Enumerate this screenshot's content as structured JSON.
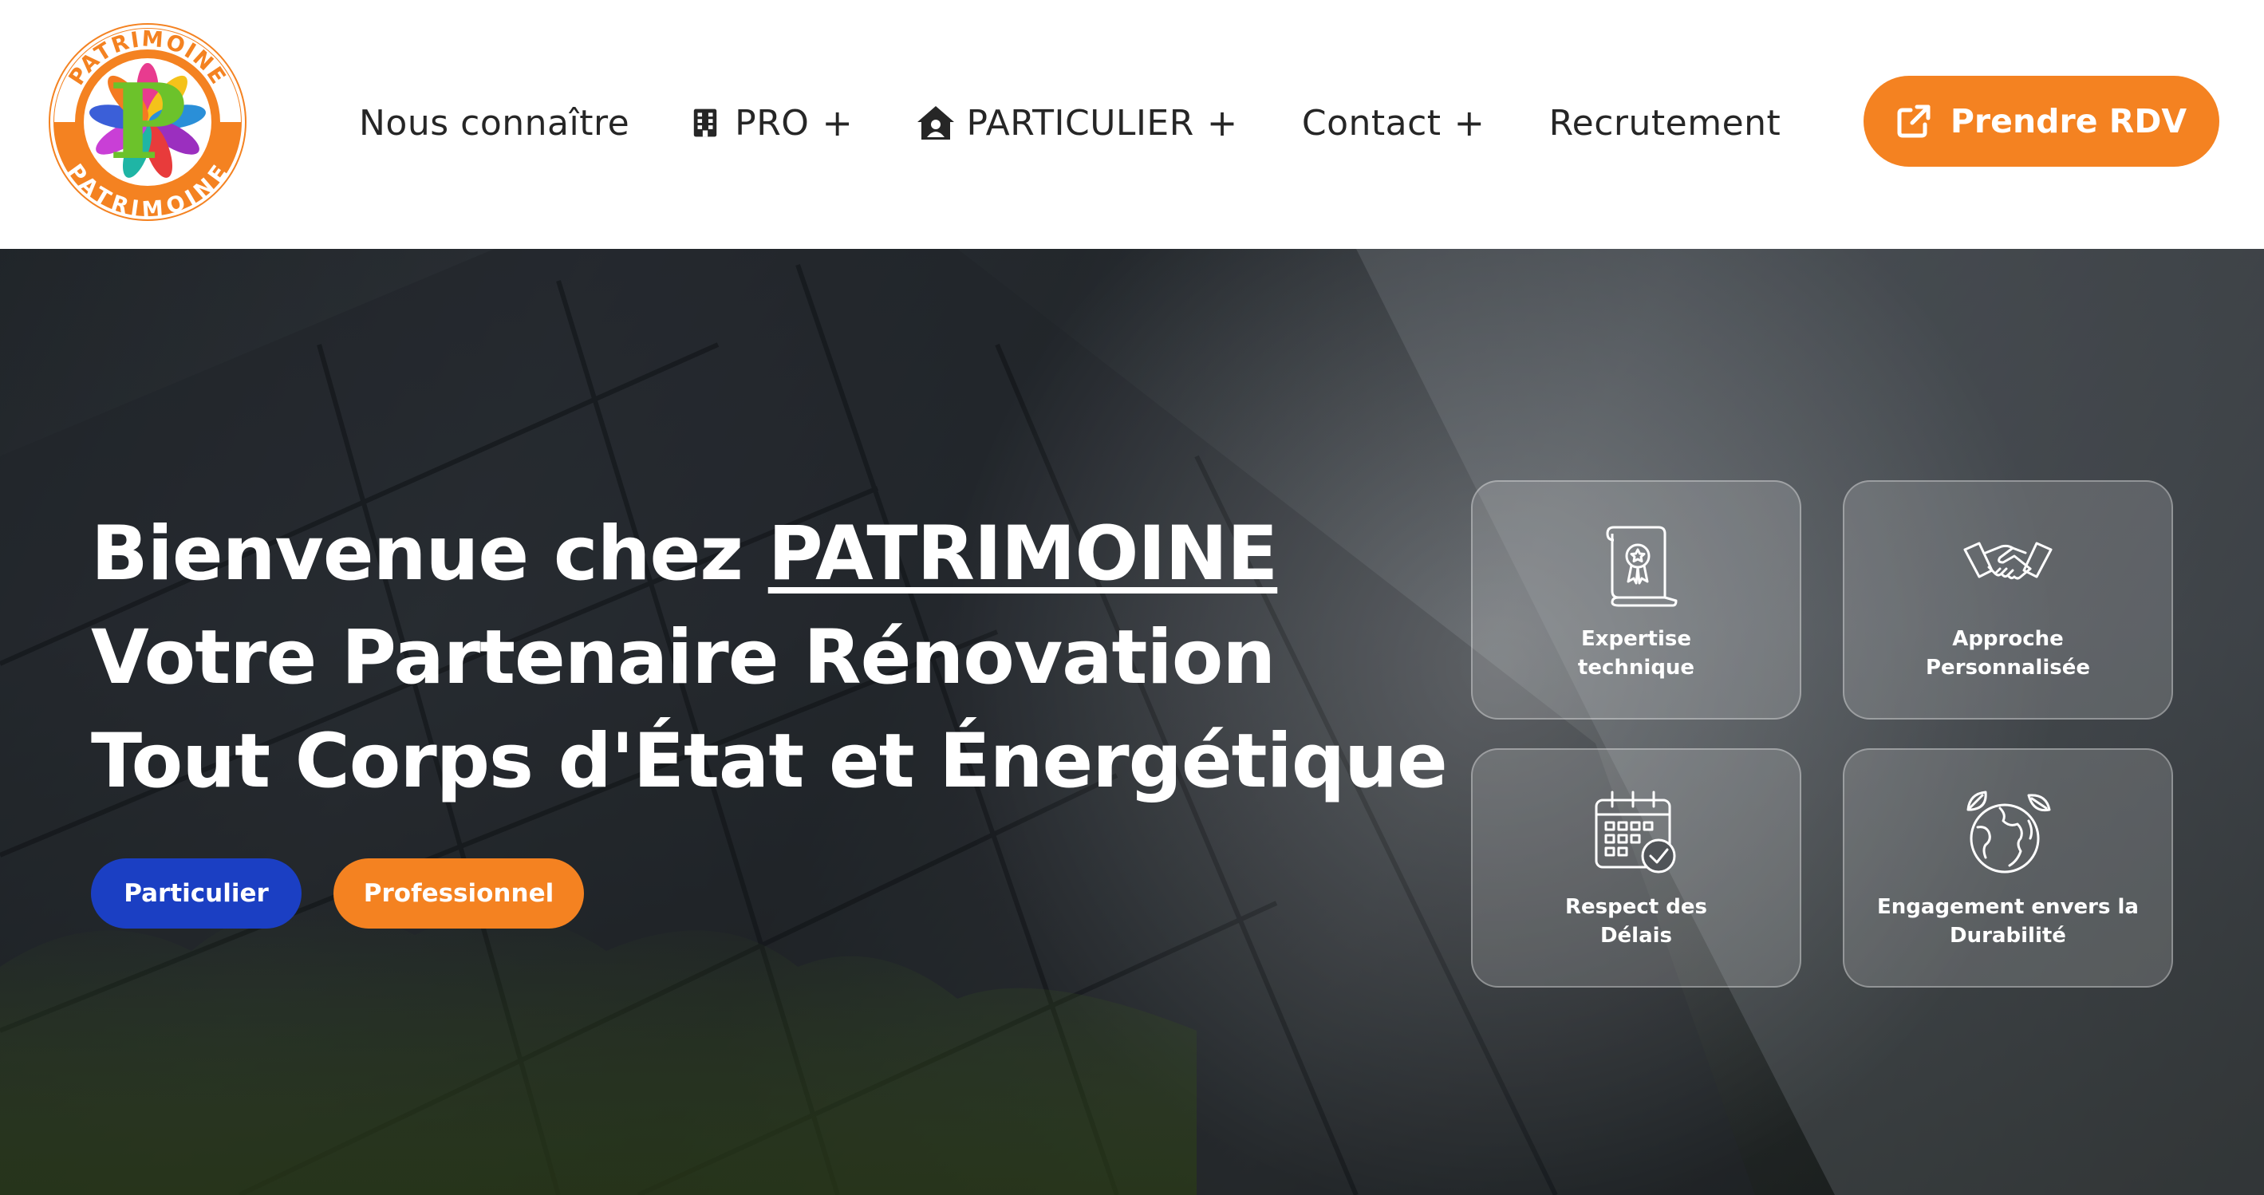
{
  "header": {
    "logo": {
      "text_top": "PATRIMOINE",
      "text_bottom": "PATRIMOINE",
      "letter": "P"
    },
    "nav": [
      {
        "label": "Nous connaître",
        "has_plus": false,
        "icon": ""
      },
      {
        "label": "PRO",
        "has_plus": true,
        "icon": "building-icon"
      },
      {
        "label": "PARTICULIER",
        "has_plus": true,
        "icon": "house-user-icon"
      },
      {
        "label": "Contact",
        "has_plus": true,
        "icon": ""
      },
      {
        "label": "Recrutement",
        "has_plus": false,
        "icon": ""
      }
    ],
    "plus": "+",
    "cta_label": "Prendre RDV",
    "cta_icon": "external-link-icon"
  },
  "hero": {
    "title_line1_prefix": "Bienvenue chez ",
    "title_line1_brand": "PATRIMOINE",
    "title_line2": "Votre Partenaire Rénovation",
    "title_line3": "Tout Corps d'État et Énergétique",
    "btn_particulier": "Particulier",
    "btn_professionnel": "Professionnel",
    "cards": [
      {
        "label": "Expertise\ntechnique",
        "icon": "certificate-scroll-icon"
      },
      {
        "label": "Approche Personnalisée",
        "icon": "handshake-icon"
      },
      {
        "label": "Respect des\nDélais",
        "icon": "calendar-check-icon"
      },
      {
        "label": "Engagement envers la\nDurabilité",
        "icon": "eco-globe-icon"
      }
    ]
  },
  "colors": {
    "brand_orange": "#f48221",
    "brand_blue": "#1b3fc3",
    "nav_text": "#262626",
    "hero_text": "#ffffff"
  }
}
